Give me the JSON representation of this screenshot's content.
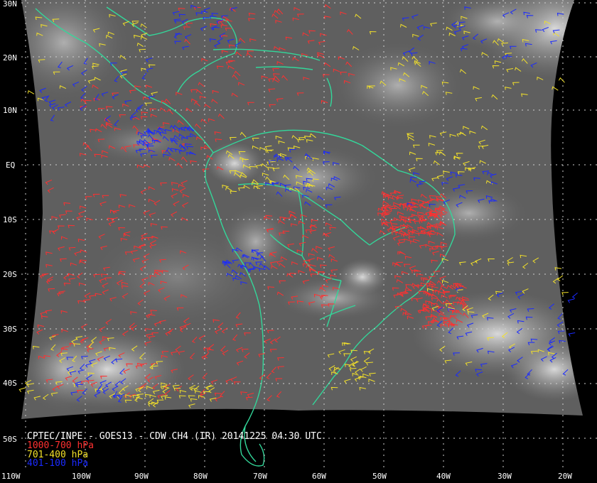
{
  "map": {
    "lat_labels": [
      "30N",
      "20N",
      "10N",
      "EQ",
      "10S",
      "20S",
      "30S",
      "40S",
      "50S"
    ],
    "lon_labels": [
      "110W",
      "100W",
      "90W",
      "80W",
      "70W",
      "60W",
      "50W",
      "40W",
      "30W",
      "20W"
    ],
    "colors": {
      "background": "#000000",
      "coastline": "#33d79a",
      "grid": "#cfcfcf",
      "low_winds": "#ff3030",
      "mid_winds": "#f2e02a",
      "high_winds": "#1a2aff",
      "label": "#ffffff"
    }
  },
  "caption": {
    "title": "CPTEC/INPE - GOES13 - CDW CH4 (IR) 20141225 04:30 UTC",
    "legend": [
      {
        "label": "1000-700 hPa",
        "color": "#ff3030"
      },
      {
        "label": "701-400 hPa",
        "color": "#f2e02a"
      },
      {
        "label": "401-100 hPa",
        "color": "#1a2aff"
      }
    ]
  }
}
